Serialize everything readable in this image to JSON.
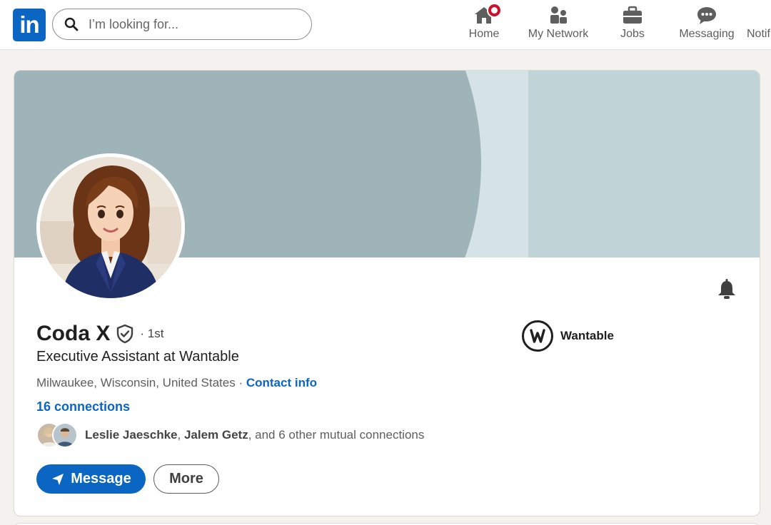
{
  "brand": {
    "logo_text": "in",
    "color": "#0a66c2"
  },
  "search": {
    "placeholder": "I’m looking for..."
  },
  "nav": [
    {
      "label": "Home",
      "icon": "home-icon",
      "has_notification": true
    },
    {
      "label": "My Network",
      "icon": "network-icon"
    },
    {
      "label": "Jobs",
      "icon": "briefcase-icon"
    },
    {
      "label": "Messaging",
      "icon": "chat-icon"
    },
    {
      "label": "Notif",
      "icon": "notifications-icon"
    }
  ],
  "profile": {
    "name": "Coda X",
    "verified_icon": "verified-shield-icon",
    "degree": "· 1st",
    "headline": "Executive Assistant at Wantable",
    "location": "Milwaukee, Wisconsin, United States",
    "location_sep": " · ",
    "contact_info": "Contact info",
    "connections": "16 connections",
    "mutual": {
      "person1": "Leslie Jaeschke",
      "sep": ", ",
      "person2": "Jalem Getz",
      "rest": ", and 6 other mutual connections"
    },
    "bell_icon": "bell-icon"
  },
  "company": {
    "name": "Wantable",
    "logo_letter": "W"
  },
  "actions": {
    "message": "Message",
    "more": "More"
  }
}
